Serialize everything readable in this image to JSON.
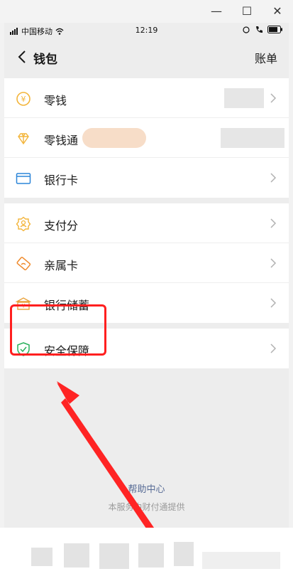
{
  "window": {
    "minimize": "—",
    "maximize": "☐",
    "close": "✕"
  },
  "status": {
    "carrier": "中国移动",
    "time": "12:19",
    "signal": "signal-icon",
    "wifi": "wifi-icon",
    "battery": "battery-icon"
  },
  "nav": {
    "title": "钱包",
    "right": "账单"
  },
  "groups": [
    {
      "items": [
        {
          "label": "零钱",
          "icon": "coin-icon",
          "color": "#f3b53b"
        },
        {
          "label": "零钱通",
          "icon": "diamond-icon",
          "color": "#f3b53b"
        },
        {
          "label": "银行卡",
          "icon": "card-icon",
          "color": "#2c85d8"
        }
      ]
    },
    {
      "items": [
        {
          "label": "支付分",
          "icon": "pay-score-icon",
          "color": "#f3b53b"
        },
        {
          "label": "亲属卡",
          "icon": "family-card-icon",
          "color": "#f08a2c"
        },
        {
          "label": "银行储蓄",
          "icon": "bank-icon",
          "color": "#e9a23a"
        }
      ]
    },
    {
      "items": [
        {
          "label": "安全保障",
          "icon": "shield-icon",
          "color": "#27b05a"
        }
      ]
    }
  ],
  "footer": {
    "help": "帮助中心",
    "note": "本服务由财付通提供"
  },
  "colors": {
    "highlight": "#ff1f1f",
    "link": "#576b95"
  }
}
